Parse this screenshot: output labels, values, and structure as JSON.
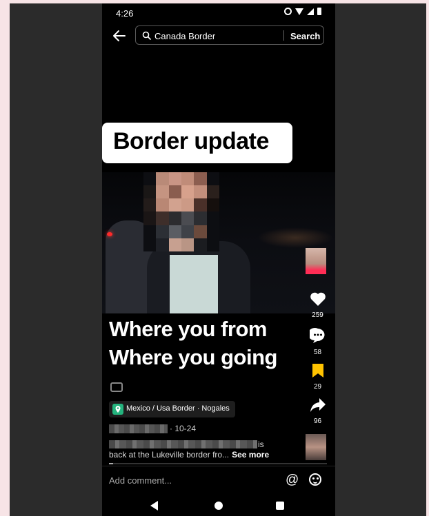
{
  "status_bar": {
    "time": "4:26"
  },
  "search": {
    "query": "Canada Border",
    "button_label": "Search"
  },
  "video": {
    "title_banner": "Border update",
    "caption_lines": [
      "Where you from",
      "Where you going"
    ]
  },
  "actions": {
    "likes": "259",
    "comments": "58",
    "saves": "29",
    "shares": "96",
    "colors": {
      "save_active": "#ffc300",
      "location_pin": "#24b47e"
    }
  },
  "post": {
    "location": "Mexico / Usa Border · Nogales",
    "date": "· 10-24",
    "description_end": "is",
    "description_line2": "back at the Lukeville border fro...",
    "see_more": "See more",
    "progress": 0.02
  },
  "comment": {
    "placeholder": "Add comment..."
  }
}
